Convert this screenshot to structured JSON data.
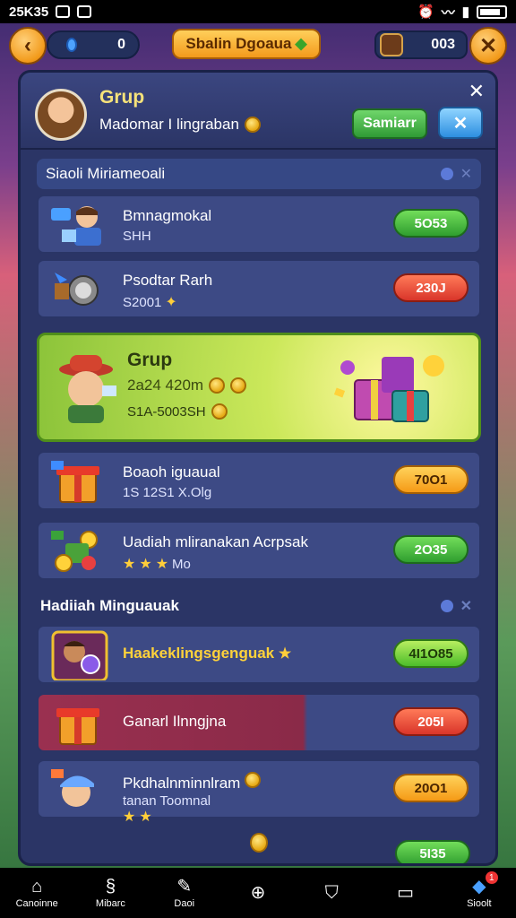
{
  "status_bar": {
    "time": "25K35",
    "right_icons": [
      "alarm-icon",
      "wifi-icon",
      "signal-icon",
      "battery-icon"
    ]
  },
  "topbar": {
    "counter": "0",
    "title": "Sbalin Dgoaua",
    "right_value": "003"
  },
  "panel": {
    "header": {
      "title": "Grup",
      "subtitle": "Madomar I lingraban",
      "green_button": "Samiarr"
    },
    "section1": "Siaoli Miriameoali",
    "rows1": [
      {
        "name": "Bmnagmokal",
        "sub": "SHH",
        "value": "5O53",
        "pill": "green"
      },
      {
        "name": "Psodtar Rarh",
        "sub": "S2001",
        "value": "230J",
        "pill": "red"
      }
    ],
    "featured": {
      "title": "Grup",
      "line1": "2a24 420m",
      "line2": "S1A-5003SH"
    },
    "rows2": [
      {
        "name": "Boaoh iguaual",
        "sub": "1S 12S1 X.Olg",
        "value": "70O1",
        "pill": "orange"
      },
      {
        "name": "Uadiah mliranakan Acrpsak",
        "sub": "Mo",
        "value": "2O35",
        "pill": "green"
      }
    ],
    "section2": "Hadiiah Minguauak",
    "rows3": [
      {
        "name": "Haakeklingsgenguak",
        "sub": "",
        "value": "4I1O85",
        "pill": "lime"
      },
      {
        "name": "Ganarl Ilnngjna",
        "sub": "",
        "value": "205I",
        "pill": "red"
      },
      {
        "name": "Pkdhalnminnlram",
        "sub": "tanan Toomnal",
        "value": "20O1",
        "pill": "orange"
      }
    ],
    "bottom_partial_value": "5I35"
  },
  "nav": [
    {
      "label": "Canoinne",
      "icon": "home-icon",
      "glyph": "⌂"
    },
    {
      "label": "Mibarc",
      "icon": "swirl-icon",
      "glyph": "§"
    },
    {
      "label": "Daoi",
      "icon": "scroll-icon",
      "glyph": "✎"
    },
    {
      "label": "",
      "icon": "compass-icon",
      "glyph": "⊕"
    },
    {
      "label": "",
      "icon": "shield-icon",
      "glyph": "⛉"
    },
    {
      "label": "",
      "icon": "ticket-icon",
      "glyph": "▭"
    },
    {
      "label": "Sioolt",
      "icon": "box-icon",
      "glyph": "◆",
      "badge": "1"
    }
  ],
  "colors": {
    "panel": "#2b3566",
    "accent_orange": "#f29a1a",
    "featured_green": "#8cc43a"
  }
}
